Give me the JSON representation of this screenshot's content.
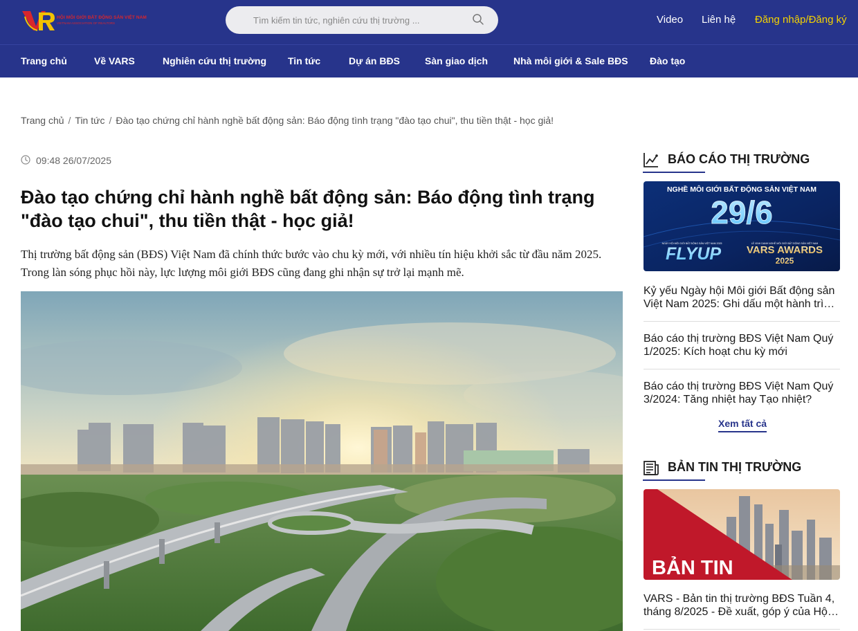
{
  "header": {
    "logo_line1": "HỘI MÔI GIỚI BẤT ĐỘNG SẢN VIỆT NAM",
    "logo_line2": "VIETNAM ASSOCIATION OF REALTORS",
    "search_placeholder": "Tìm kiếm tin tức, nghiên cứu thị trường ...",
    "links": {
      "video": "Video",
      "contact": "Liên hệ",
      "login": "Đăng nhập/Đăng ký"
    }
  },
  "nav": {
    "items": [
      "Trang chủ",
      "Về VARS",
      "Nghiên cứu thị trường",
      "Tin tức",
      "Dự án BĐS",
      "Sàn giao dịch",
      "Nhà môi giới & Sale BĐS",
      "Đào tạo"
    ]
  },
  "breadcrumb": {
    "home": "Trang chủ",
    "section": "Tin tức",
    "current": "Đào tạo chứng chỉ hành nghề bất động sản: Báo động tình trạng \"đào tạo chui\", thu tiền thật - học giả!"
  },
  "article": {
    "timestamp": "09:48 26/07/2025",
    "title": "Đào tạo chứng chỉ hành nghề bất động sản: Báo động tình trạng \"đào tạo chui\", thu tiền thật - học giả!",
    "lead": "Thị trường bất động sản (BĐS) Việt Nam đã chính thức bước vào chu kỳ mới, với nhiều tín hiệu khởi sắc từ đầu năm 2025. Trong làn sóng phục hồi này, lực lượng môi giới BĐS cũng đang ghi nhận sự trở lại mạnh mẽ."
  },
  "sidebar": {
    "market_reports": {
      "heading": "BÁO CÁO THỊ TRƯỜNG",
      "banner": {
        "top": "NGHỀ MÔI GIỚI BẤT ĐỘNG SẢN VIỆT NAM",
        "date": "29/6",
        "left_small": "NGÀY HỘI MÔI GIỚI BẤT ĐỘNG SẢN VIỆT NAM 2025",
        "left_big": "FLYUP",
        "right_small": "LỄ VINH DANH NGHỀ MÔI GIỚI BẤT ĐỘNG SẢN VIỆT NAM",
        "right_big": "VARS AWARDS",
        "right_year": "2025"
      },
      "items": [
        "Kỷ yếu Ngày hội Môi giới Bất động sản Việt Nam 2025: Ghi dấu một hành trình đáng nhớ",
        "Báo cáo thị trường BĐS Việt Nam Quý 1/2025: Kích hoạt chu kỳ mới",
        "Báo cáo thị trường BĐS Việt Nam Quý 3/2024: Tăng nhiệt hay Tạo nhiệt?"
      ],
      "see_all": "Xem tất cả"
    },
    "market_bulletin": {
      "heading": "BẢN TIN THỊ TRƯỜNG",
      "banner_text": "BẢN TIN",
      "items": [
        "VARS - Bản tin thị trường BĐS Tuần 4, tháng 8/2025 - Đề xuất, góp ý của Hội Môi giới"
      ]
    }
  },
  "colors": {
    "brand_blue": "#27348b",
    "login_yellow": "#f5d300",
    "logo_red": "#d8262d",
    "bulletin_red": "#c0182a"
  }
}
